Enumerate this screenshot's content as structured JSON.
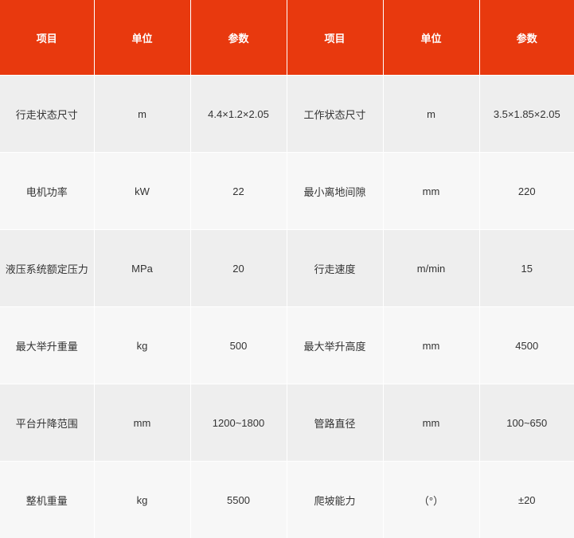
{
  "colors": {
    "header_bg": "#e8390e",
    "header_text": "#ffffff",
    "row_odd_bg": "#eeeeee",
    "row_even_bg": "#f7f7f7",
    "body_text": "#333333"
  },
  "table": {
    "headers": [
      "项目",
      "单位",
      "参数",
      "项目",
      "单位",
      "参数"
    ],
    "rows": [
      [
        "行走状态尺寸",
        "m",
        "4.4×1.2×2.05",
        "工作状态尺寸",
        "m",
        "3.5×1.85×2.05"
      ],
      [
        "电机功率",
        "kW",
        "22",
        "最小离地间隙",
        "mm",
        "220"
      ],
      [
        "液压系统额定压力",
        "MPa",
        "20",
        "行走速度",
        "m/min",
        "15"
      ],
      [
        "最大举升重量",
        "kg",
        "500",
        "最大举升高度",
        "mm",
        "4500"
      ],
      [
        "平台升降范围",
        "mm",
        "1200~1800",
        "管路直径",
        "mm",
        "100~650"
      ],
      [
        "整机重量",
        "kg",
        "5500",
        "爬坡能力",
        "（°）",
        "±20"
      ]
    ]
  }
}
